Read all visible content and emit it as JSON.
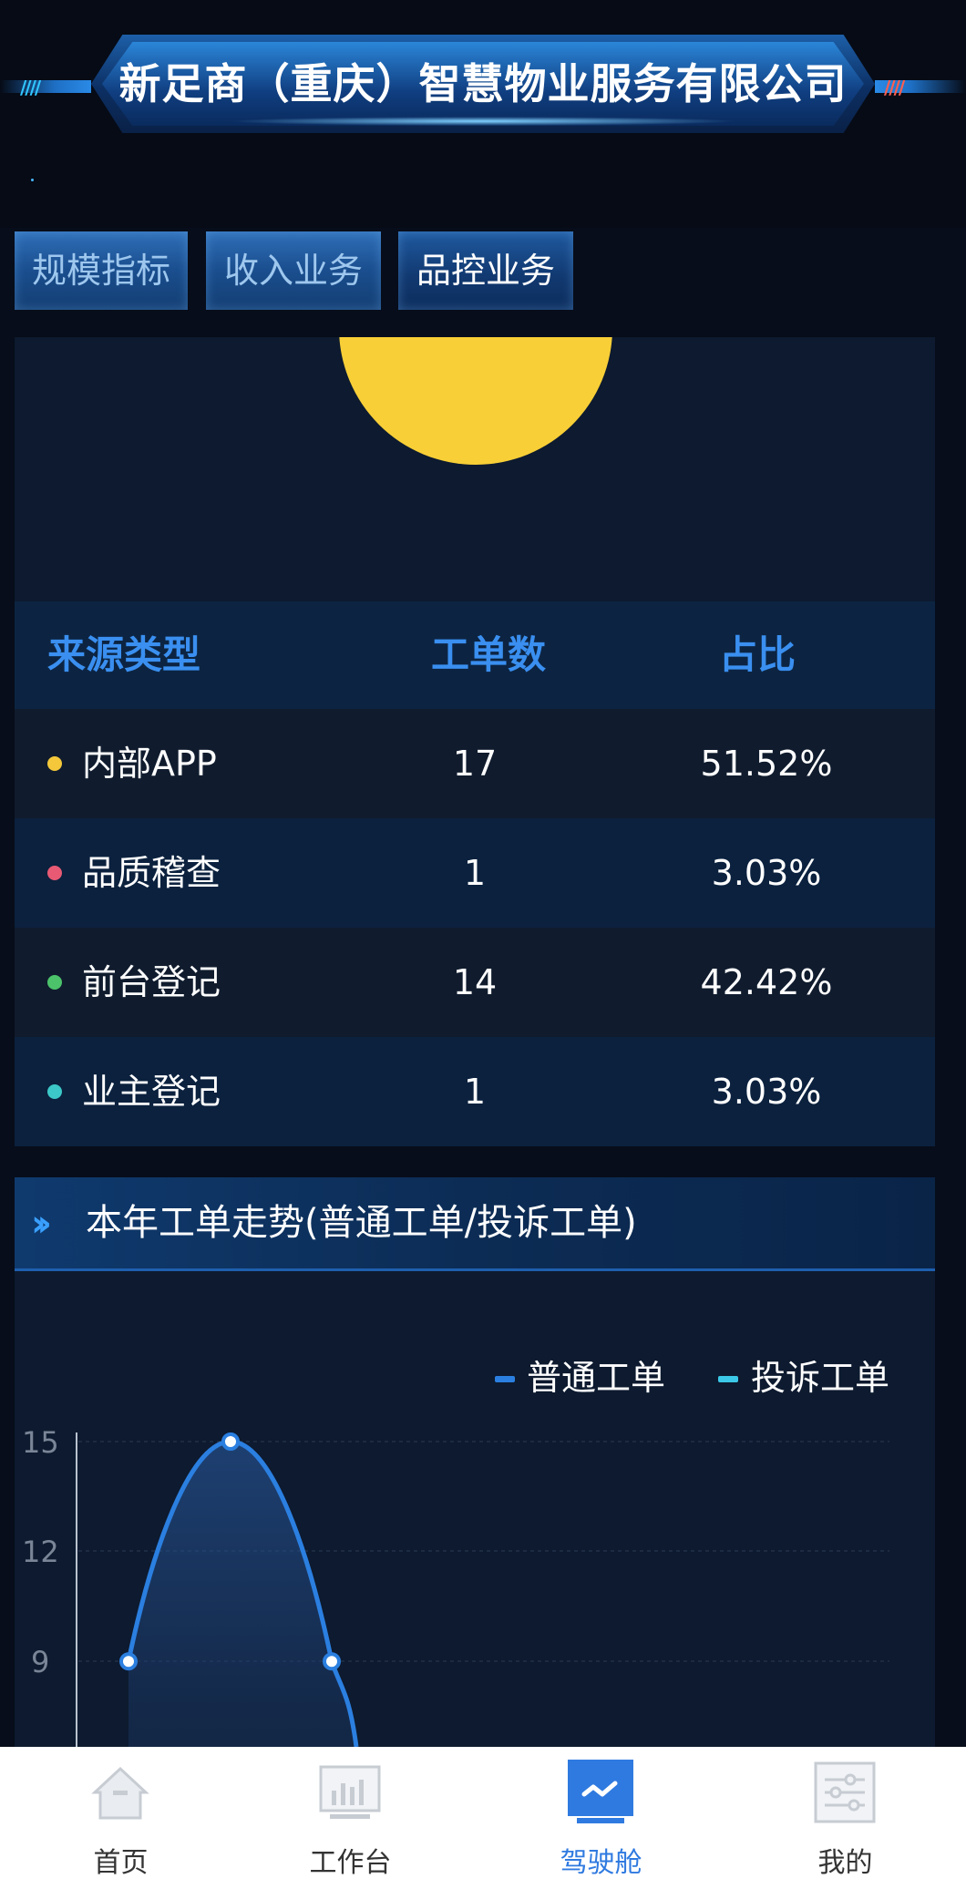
{
  "header": {
    "title": "新足商（重庆）智慧物业服务有限公司"
  },
  "tabs": [
    {
      "label": "规模指标",
      "active": false
    },
    {
      "label": "收入业务",
      "active": false
    },
    {
      "label": "品控业务",
      "active": true
    }
  ],
  "source_table": {
    "columns": [
      "来源类型",
      "工单数",
      "占比"
    ],
    "rows": [
      {
        "name": "内部APP",
        "count": "17",
        "percent": "51.52%",
        "color": "#f4c83a"
      },
      {
        "name": "品质稽查",
        "count": "1",
        "percent": "3.03%",
        "color": "#e85a74"
      },
      {
        "name": "前台登记",
        "count": "14",
        "percent": "42.42%",
        "color": "#4cc36a"
      },
      {
        "name": "业主登记",
        "count": "1",
        "percent": "3.03%",
        "color": "#3cc8c8"
      }
    ],
    "pie_color": "#f8cf37"
  },
  "trend": {
    "title": "本年工单走势(普通工单/投诉工单)"
  },
  "chart_data": {
    "type": "line",
    "title": "本年工单走势(普通工单/投诉工单)",
    "y_ticks": [
      "15",
      "12",
      "9"
    ],
    "yrange": [
      0,
      15
    ],
    "legend_position": "top-right",
    "series": [
      {
        "name": "普通工单",
        "color": "#2b7fe0",
        "points": [
          9,
          15,
          9
        ]
      },
      {
        "name": "投诉工单",
        "color": "#3cc8e8",
        "points": []
      }
    ]
  },
  "bottom_nav": [
    {
      "label": "首页",
      "icon": "home-icon",
      "active": false
    },
    {
      "label": "工作台",
      "icon": "workbench-icon",
      "active": false
    },
    {
      "label": "驾驶舱",
      "icon": "cockpit-icon",
      "active": true
    },
    {
      "label": "我的",
      "icon": "settings-sliders-icon",
      "active": false
    }
  ]
}
